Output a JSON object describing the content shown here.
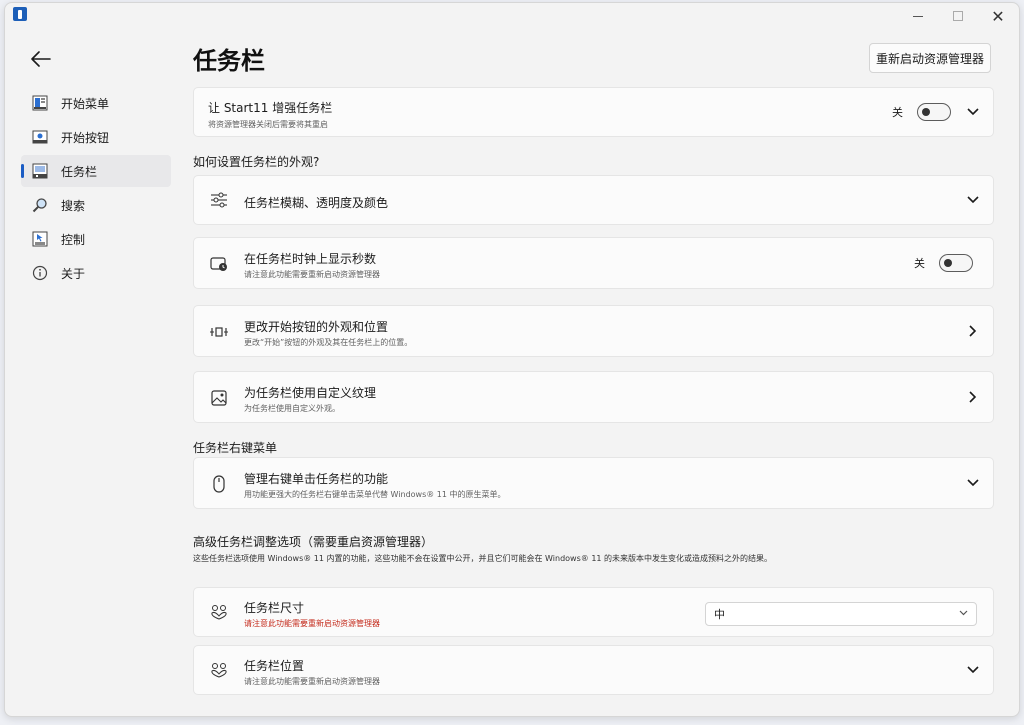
{
  "window": {
    "minimize_label": "—",
    "close_label": "✕"
  },
  "sidebar": {
    "back_icon": "back-arrow-icon",
    "items": [
      {
        "label": "开始菜单",
        "icon": "start-menu-icon",
        "active": false
      },
      {
        "label": "开始按钮",
        "icon": "start-button-icon",
        "active": false
      },
      {
        "label": "任务栏",
        "icon": "taskbar-icon",
        "active": true
      },
      {
        "label": "搜索",
        "icon": "search-icon",
        "active": false
      },
      {
        "label": "控制",
        "icon": "control-icon",
        "active": false
      },
      {
        "label": "关于",
        "icon": "info-icon",
        "active": false
      }
    ]
  },
  "header": {
    "title": "任务栏",
    "restart_button": "重新启动资源管理器"
  },
  "enhance": {
    "title": "让 Start11 增强任务栏",
    "desc": "将资源管理器关闭后需要将其重启",
    "toggle_label": "关"
  },
  "appearance_section": {
    "heading": "如何设置任务栏的外观?"
  },
  "cards": {
    "blur": {
      "title": "任务栏模糊、透明度及颜色"
    },
    "seconds": {
      "title": "在任务栏时钟上显示秒数",
      "desc": "请注意此功能需要重新启动资源管理器",
      "toggle_label": "关"
    },
    "start_button": {
      "title": "更改开始按钮的外观和位置",
      "desc": "更改“开始”按钮的外观及其在任务栏上的位置。"
    },
    "texture": {
      "title": "为任务栏使用自定义纹理",
      "desc": "为任务栏使用自定义外观。"
    },
    "right_click": {
      "title": "管理右键单击任务栏的功能",
      "desc": "用功能更强大的任务栏右键单击菜单代替 Windows® 11 中的原生菜单。"
    },
    "size": {
      "title": "任务栏尺寸",
      "desc": "请注意此功能需要重新启动资源管理器",
      "selected": "中"
    },
    "position": {
      "title": "任务栏位置",
      "desc": "请注意此功能需要重新启动资源管理器"
    }
  },
  "context_section": {
    "heading": "任务栏右键菜单"
  },
  "advanced_section": {
    "heading": "高级任务栏调整选项（需要重启资源管理器）",
    "sub": "这些任务栏选项使用 Windows® 11 内置的功能，这些功能不会在设置中公开，并且它们可能会在 Windows® 11 的未来版本中发生变化或造成预料之外的结果。"
  },
  "colors": {
    "accent": "#1a5cc4",
    "warning": "#c42b1c"
  }
}
